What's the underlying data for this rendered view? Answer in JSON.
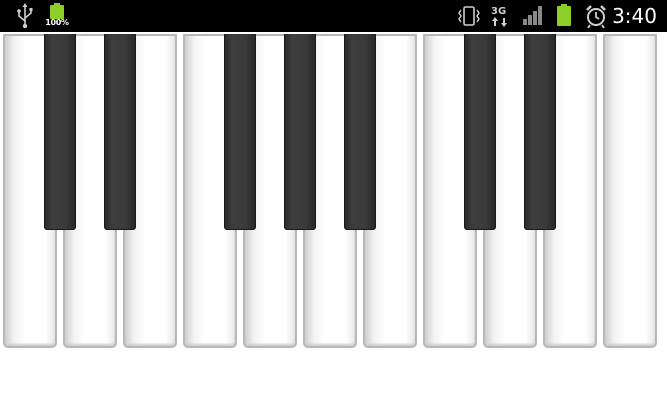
{
  "status_bar": {
    "battery_label": "100%",
    "network": "3G",
    "time": "3:40",
    "icons": [
      "usb-icon",
      "battery-icon",
      "vibrate-icon",
      "network-3g-icon",
      "signal-icon",
      "battery-icon",
      "alarm-icon"
    ],
    "colors": {
      "background": "#000000",
      "battery_green": "#8dcf28",
      "text": "#ffffff"
    }
  },
  "piano": {
    "white_keys": 11,
    "black_keys": 7,
    "colors": {
      "white_key": "#ffffff",
      "black_key": "#3a3a3a",
      "key_border": "#b8b8b8"
    }
  }
}
